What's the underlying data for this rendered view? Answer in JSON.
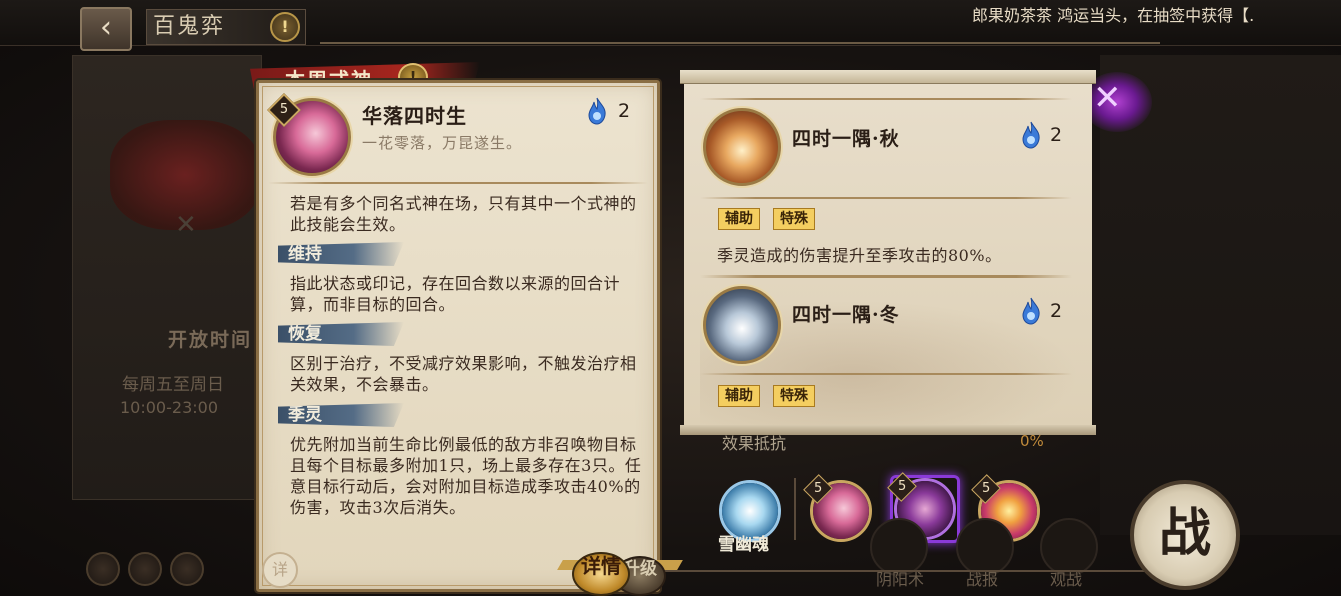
{
  "header": {
    "back_icon": "back-arrow-icon",
    "title": "百鬼弈",
    "marquee": "郎果奶茶茶 鸿运当头，在抽签中获得【."
  },
  "background": {
    "open_time_label": "开放时间",
    "weekday_label": "每周五至周日",
    "time_range": "10:00-23:00"
  },
  "ribbon": {
    "label": "本周式神"
  },
  "skill_main": {
    "level": "5",
    "name": "华落四时生",
    "subtitle": "一花零落，万昆遂生。",
    "cost": "2",
    "description": "若是有多个同名式神在场，只有其中一个式神的此技能会生效。",
    "terms": [
      {
        "term": "维持",
        "text": "指此状态或印记，存在回合数以来源的回合计算，而非目标的回合。"
      },
      {
        "term": "恢复",
        "text": "区别于治疗，不受减疗效果影响，不触发治疗相关效果，不会暴击。"
      },
      {
        "term": "季灵",
        "text": "优先附加当前生命比例最低的敌方非召唤物目标且每个目标最多附加1只，场上最多存在3只。任意目标行动后，会对附加目标造成季攻击40%的伤害，攻击3次后消失。"
      }
    ]
  },
  "bottom_tabs": {
    "seal": "详",
    "details": "详情",
    "upgrade": "升级"
  },
  "summons": [
    {
      "name": "四时一隅·秋",
      "cost": "2",
      "tags": [
        "辅助",
        "特殊"
      ],
      "description": "季灵造成的伤害提升至季攻击的80%。"
    },
    {
      "name": "四时一隅·冬",
      "cost": "2",
      "tags": [
        "辅助",
        "特殊"
      ]
    }
  ],
  "stats": {
    "label": "效果抵抗",
    "value": "0%"
  },
  "team": {
    "snow_name": "雪幽魂",
    "slots": [
      {
        "level": "5"
      },
      {
        "level": "5"
      },
      {
        "level": "5"
      }
    ]
  },
  "bottom_nav": {
    "onmyoji": "阴阳术",
    "battle_report": "战报",
    "spectate": "观战"
  },
  "fight_button": "战",
  "colors": {
    "card_bg": "#e6dcc6",
    "term_tag": "#4d6480",
    "tag_yellow": "#f4ce60",
    "accent_gold": "#c9a660",
    "orb_blue": "#3a7ad8"
  }
}
